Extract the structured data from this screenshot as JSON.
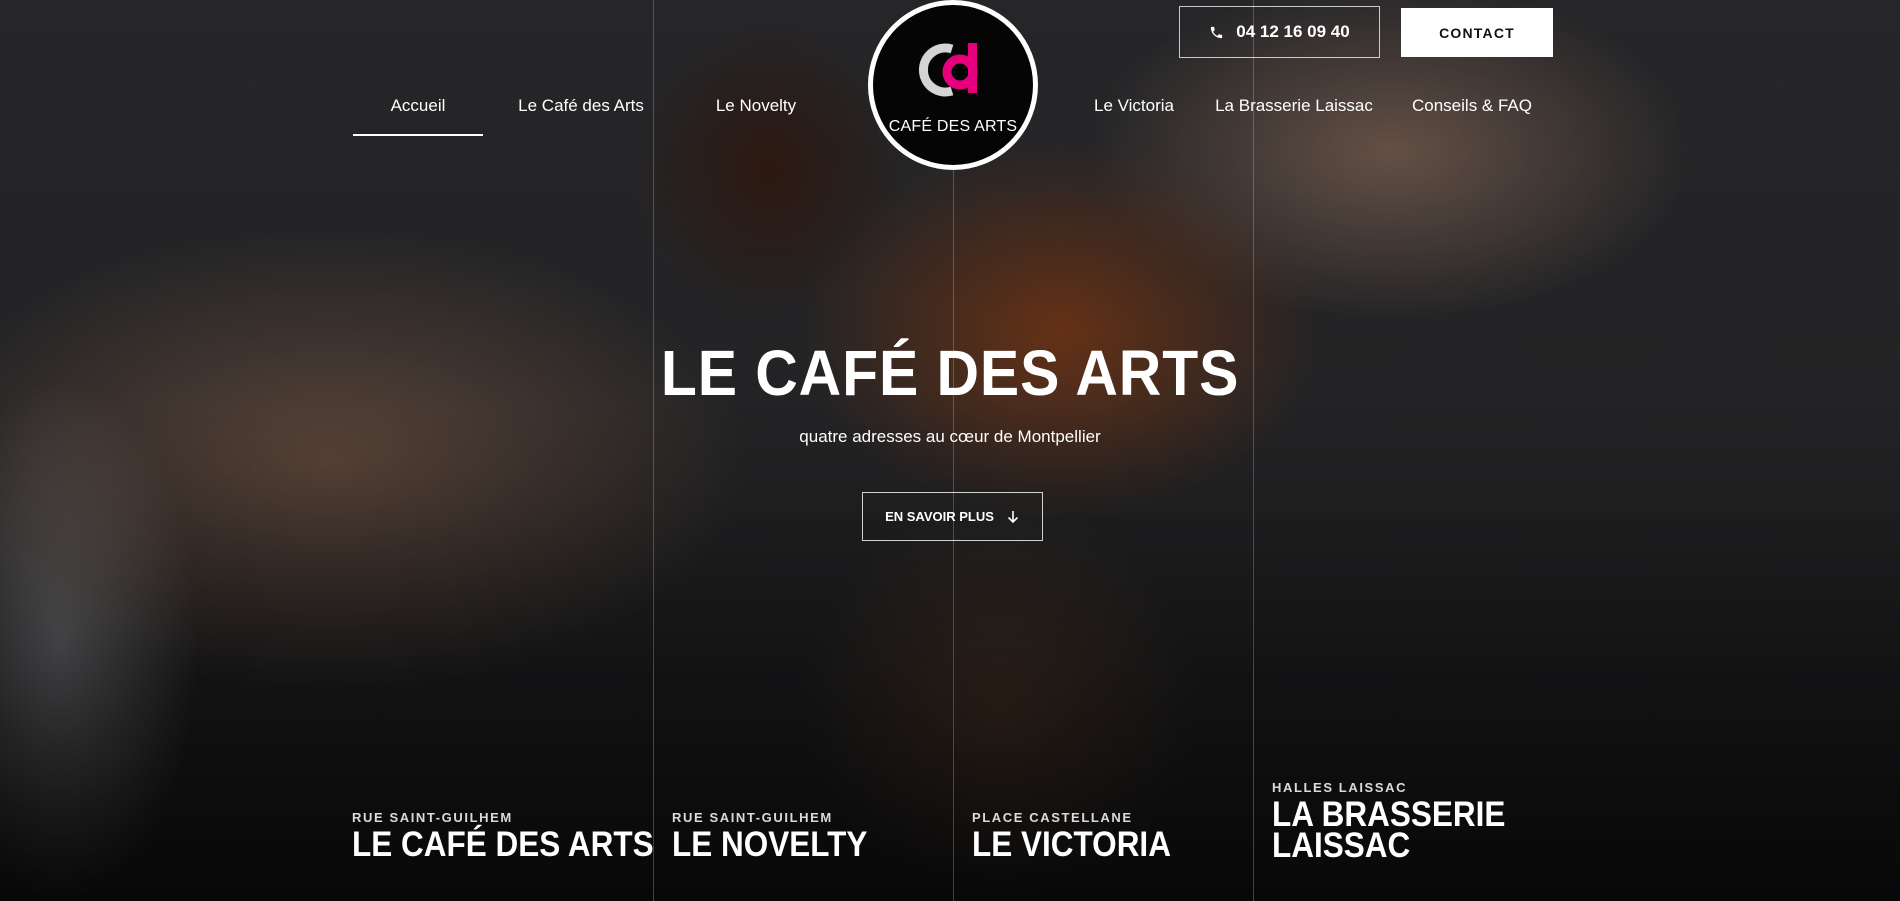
{
  "brand": {
    "logo_text": "CAFÉ DES ARTS",
    "accent_color": "#e6007e"
  },
  "nav": {
    "items": [
      {
        "label": "Accueil",
        "active": true
      },
      {
        "label": "Le Café des Arts",
        "active": false
      },
      {
        "label": "Le Novelty",
        "active": false
      },
      {
        "label": "Le Victoria",
        "active": false
      },
      {
        "label": "La Brasserie Laissac",
        "active": false
      },
      {
        "label": "Conseils & FAQ",
        "active": false
      }
    ]
  },
  "header": {
    "phone": "04 12 16 09 40",
    "phone_icon": "phone-icon",
    "contact_label": "CONTACT"
  },
  "hero": {
    "title": "LE CAFÉ DES ARTS",
    "subtitle": "quatre adresses au cœur de Montpellier",
    "cta_label": "EN SAVOIR PLUS",
    "cta_icon": "arrow-down-icon"
  },
  "venues": [
    {
      "street": "RUE SAINT-GUILHEM",
      "name": "LE CAFÉ DES ARTS"
    },
    {
      "street": "RUE SAINT-GUILHEM",
      "name": "LE NOVELTY"
    },
    {
      "street": "PLACE CASTELLANE",
      "name": "LE VICTORIA"
    },
    {
      "street": "HALLES LAISSAC",
      "name": "LA BRASSERIE\nLAISSAC"
    }
  ]
}
